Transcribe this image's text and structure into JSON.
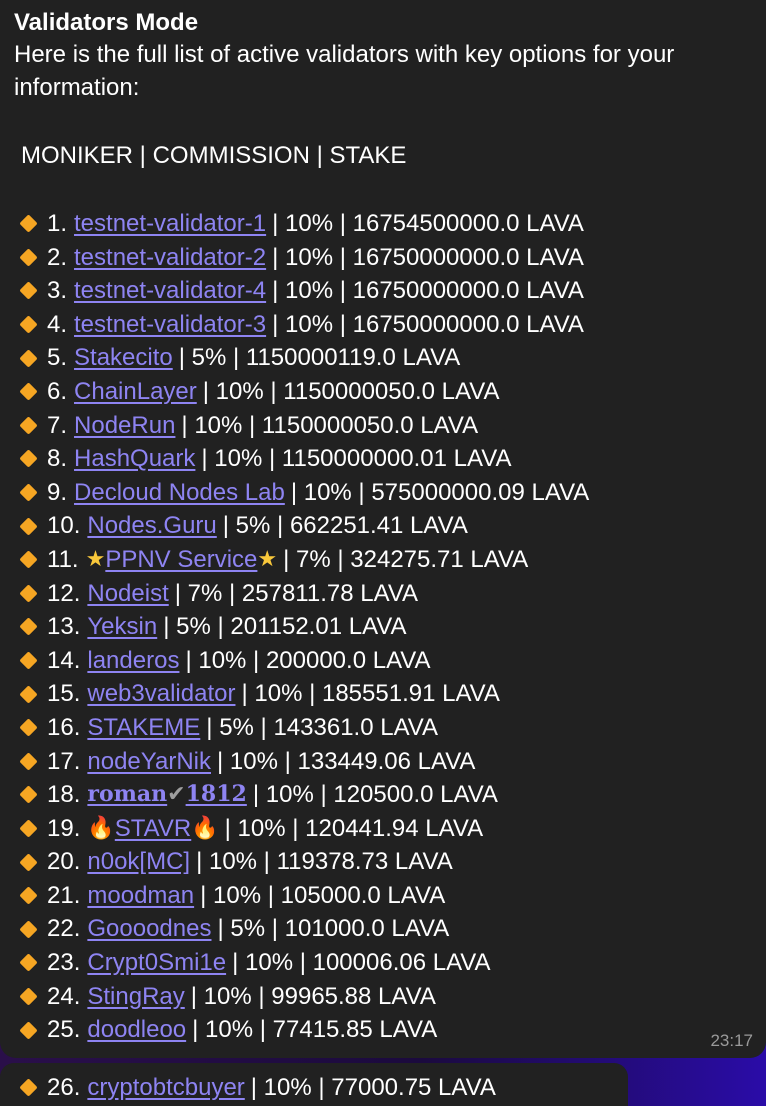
{
  "message": {
    "title": "Validators Mode",
    "intro": "Here is the full list of active validators with key options for your information:",
    "columns_header": "MONIKER | COMMISSION | STAKE",
    "time": "23:17",
    "validators": [
      {
        "num": "1.",
        "moniker": "testnet-validator-1",
        "rest": "| 10% | 16754500000.0 LAVA"
      },
      {
        "num": "2.",
        "moniker": "testnet-validator-2",
        "rest": "| 10% | 16750000000.0 LAVA"
      },
      {
        "num": "3.",
        "moniker": "testnet-validator-4",
        "rest": "| 10% | 16750000000.0 LAVA"
      },
      {
        "num": "4.",
        "moniker": "testnet-validator-3",
        "rest": "| 10% | 16750000000.0 LAVA"
      },
      {
        "num": "5.",
        "moniker": "Stakecito",
        "rest": "| 5% | 1150000119.0 LAVA"
      },
      {
        "num": "6.",
        "moniker": "ChainLayer",
        "rest": "| 10% | 1150000050.0 LAVA"
      },
      {
        "num": "7.",
        "moniker": "NodeRun",
        "rest": "| 10% | 1150000050.0 LAVA"
      },
      {
        "num": "8.",
        "moniker": "HashQuark",
        "rest": "| 10% | 1150000000.01 LAVA"
      },
      {
        "num": "9.",
        "moniker": "Decloud Nodes Lab",
        "rest": "| 10% | 575000000.09 LAVA"
      },
      {
        "num": "10.",
        "moniker": "Nodes.Guru",
        "rest": "| 5% | 662251.41 LAVA"
      },
      {
        "num": "11.",
        "moniker": "PPNV Service",
        "rest": "| 7% | 324275.71 LAVA",
        "decor": "star"
      },
      {
        "num": "12.",
        "moniker": "Nodeist",
        "rest": "| 7% | 257811.78 LAVA"
      },
      {
        "num": "13.",
        "moniker": "Yeksin",
        "rest": "| 5% | 201152.01 LAVA"
      },
      {
        "num": "14.",
        "moniker": "landeros",
        "rest": "| 10% | 200000.0 LAVA"
      },
      {
        "num": "15.",
        "moniker": "web3validator",
        "rest": "| 10% | 185551.91 LAVA"
      },
      {
        "num": "16.",
        "moniker": "STAKEME",
        "rest": "| 5% | 143361.0 LAVA"
      },
      {
        "num": "17.",
        "moniker": "nodeYarNik",
        "rest": "| 10% | 133449.06 LAVA"
      },
      {
        "num": "18.",
        "moniker_a": "roman",
        "moniker_b": "1812",
        "rest": "| 10% | 120500.0 LAVA",
        "decor": "check"
      },
      {
        "num": "19.",
        "moniker": "STAVR",
        "rest": "| 10% | 120441.94 LAVA",
        "decor": "fire"
      },
      {
        "num": "20.",
        "moniker": "n0ok[MC]",
        "rest": "| 10% | 119378.73 LAVA"
      },
      {
        "num": "21.",
        "moniker": "moodman",
        "rest": "| 10% | 105000.0 LAVA"
      },
      {
        "num": "22.",
        "moniker": "Goooodnes",
        "rest": "| 5% | 101000.0 LAVA"
      },
      {
        "num": "23.",
        "moniker": "Crypt0Smi1e",
        "rest": "| 10% | 100006.06 LAVA"
      },
      {
        "num": "24.",
        "moniker": "StingRay",
        "rest": "| 10% | 99965.88 LAVA"
      },
      {
        "num": "25.",
        "moniker": "doodleoo",
        "rest": "| 10% | 77415.85 LAVA"
      }
    ]
  },
  "next_message": {
    "validators": [
      {
        "num": "26.",
        "moniker": "cryptobtcbuyer",
        "rest": "| 10% | 77000.75 LAVA"
      }
    ]
  },
  "icons": {
    "bullet": "orange-diamond-icon",
    "star": "star-icon",
    "fire": "fire-icon",
    "check": "check-mark-icon"
  },
  "colors": {
    "bubble": "#212121",
    "link": "#8e84f2",
    "bullet": "#f6a623",
    "time": "#9a9a9a"
  },
  "glyphs": {
    "star": "★",
    "fire": "🔥",
    "check": "✔"
  }
}
